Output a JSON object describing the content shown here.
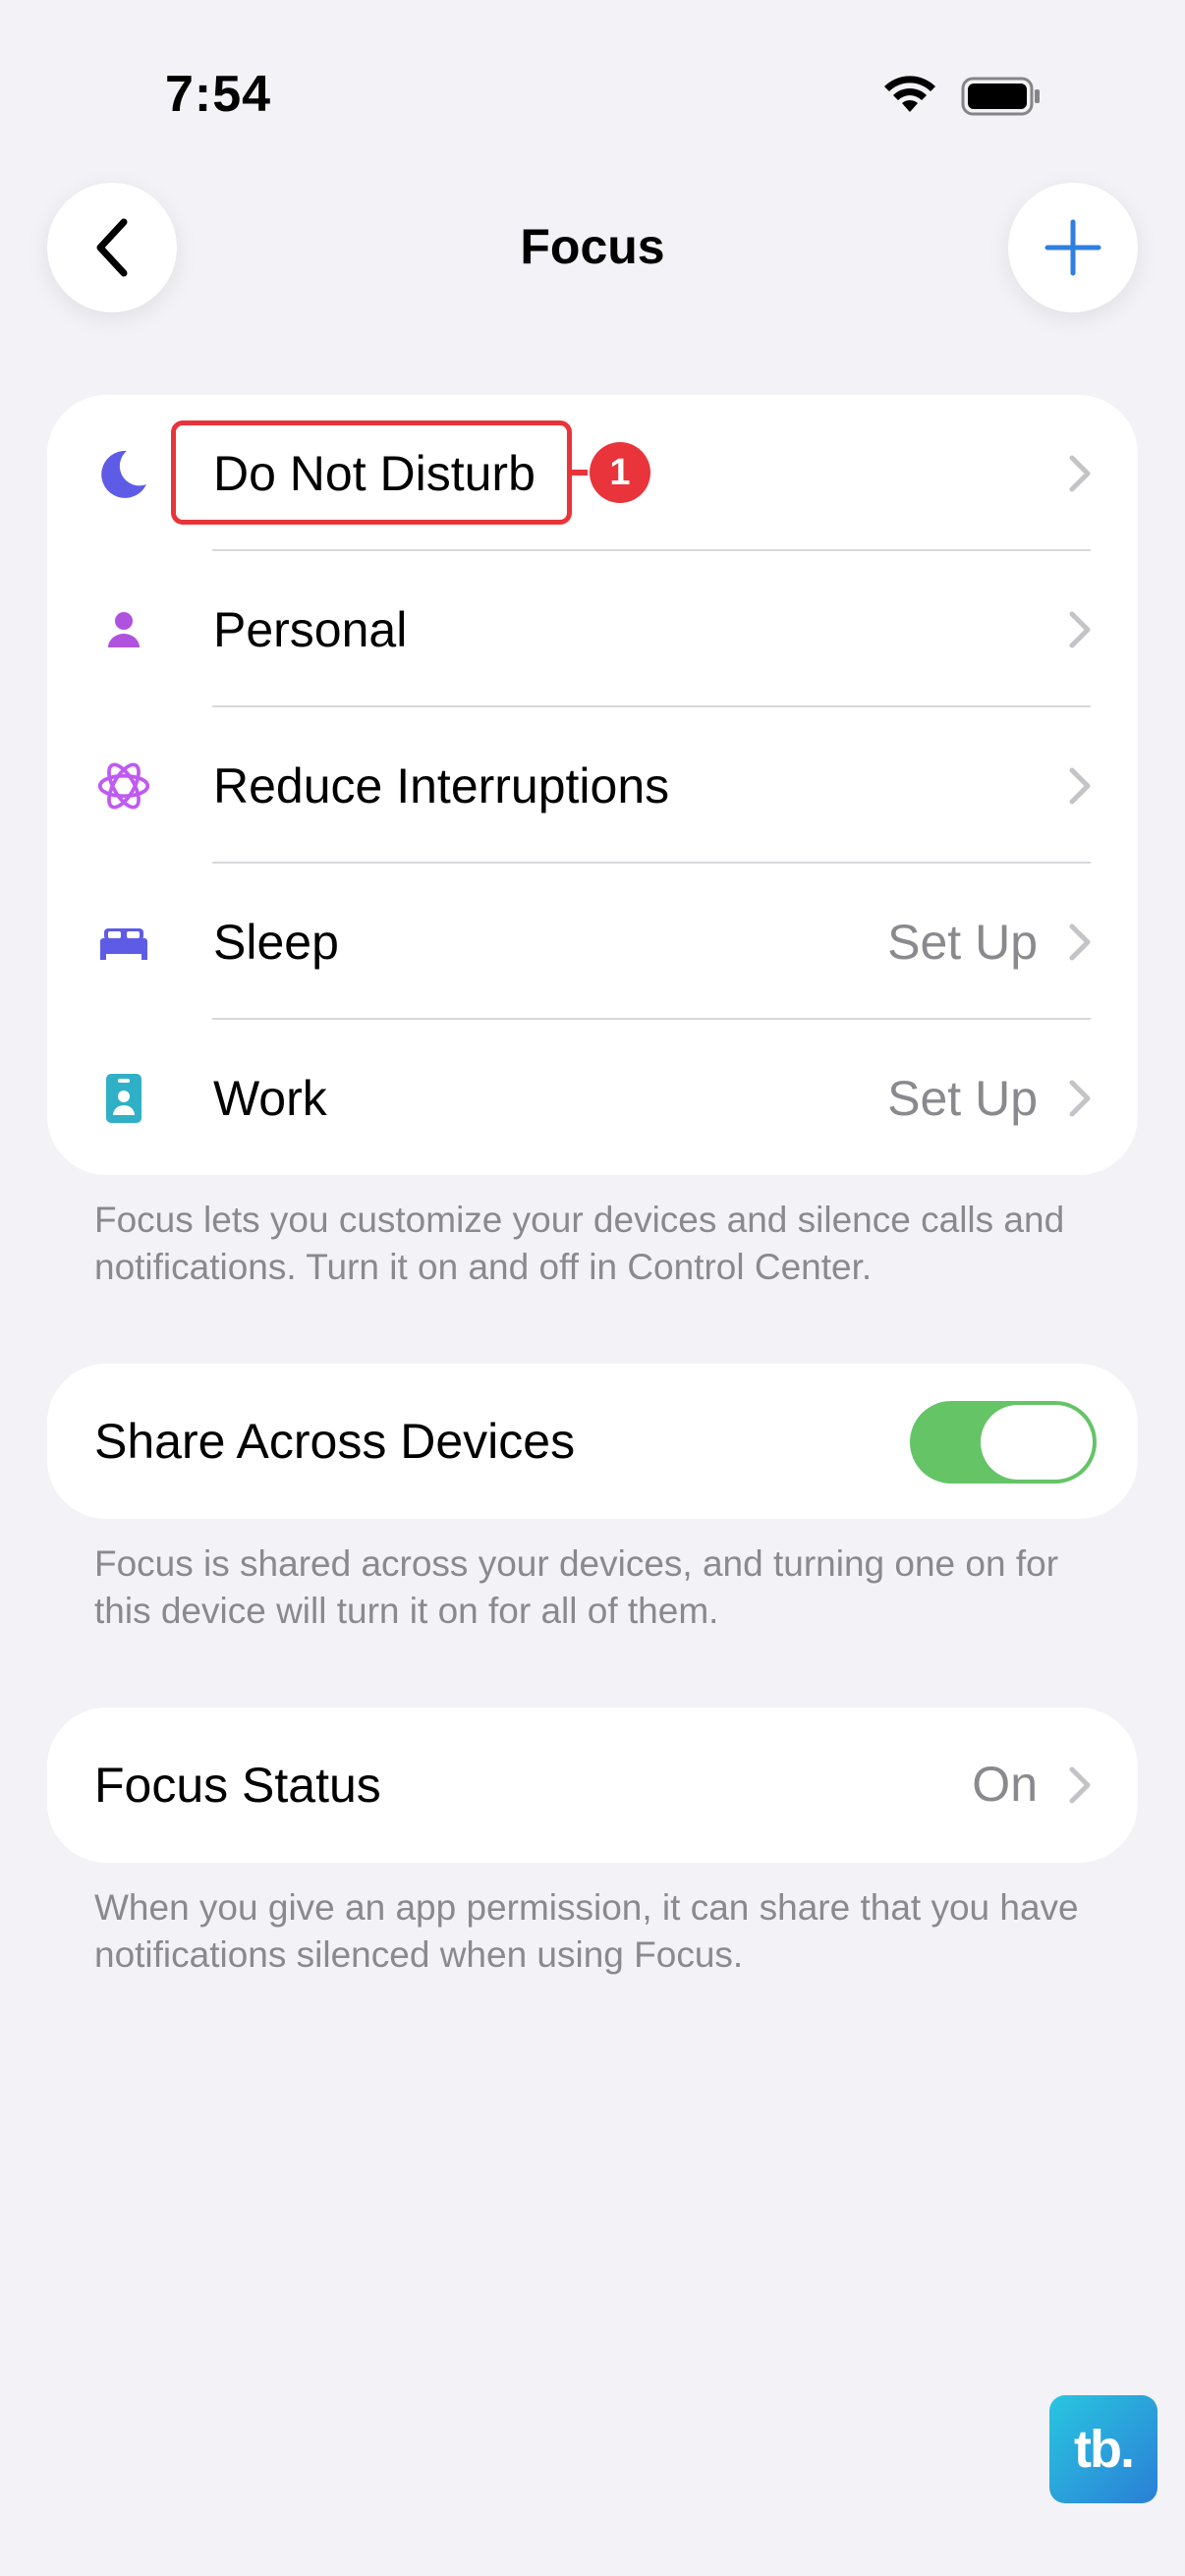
{
  "status_bar": {
    "time": "7:54",
    "wifi_icon": "wifi-icon",
    "battery_icon": "battery-icon"
  },
  "nav": {
    "title": "Focus",
    "back_icon": "chevron-left-icon",
    "add_icon": "plus-icon"
  },
  "focus_modes": [
    {
      "label": "Do Not Disturb",
      "value": "",
      "icon": "moon-icon",
      "color": "#5e5ce6"
    },
    {
      "label": "Personal",
      "value": "",
      "icon": "person-icon",
      "color": "#af52de"
    },
    {
      "label": "Reduce Interruptions",
      "value": "",
      "icon": "atom-icon",
      "color": "#bf5af2"
    },
    {
      "label": "Sleep",
      "value": "Set Up",
      "icon": "bed-icon",
      "color": "#5e5ce6"
    },
    {
      "label": "Work",
      "value": "Set Up",
      "icon": "id-badge-icon",
      "color": "#30b0c7"
    }
  ],
  "focus_footnote": "Focus lets you customize your devices and silence calls and notifications. Turn it on and off in Control Center.",
  "share": {
    "label": "Share Across Devices",
    "enabled": true,
    "toggle_color": "#65c466"
  },
  "share_footnote": "Focus is shared across your devices, and turning one on for this device will turn it on for all of them.",
  "focus_status": {
    "label": "Focus Status",
    "value": "On"
  },
  "status_footnote": "When you give an app permission, it can share that you have notifications silenced when using Focus.",
  "annotation": {
    "badge": "1",
    "color": "#e8343a"
  },
  "watermark": {
    "text": "tb."
  }
}
